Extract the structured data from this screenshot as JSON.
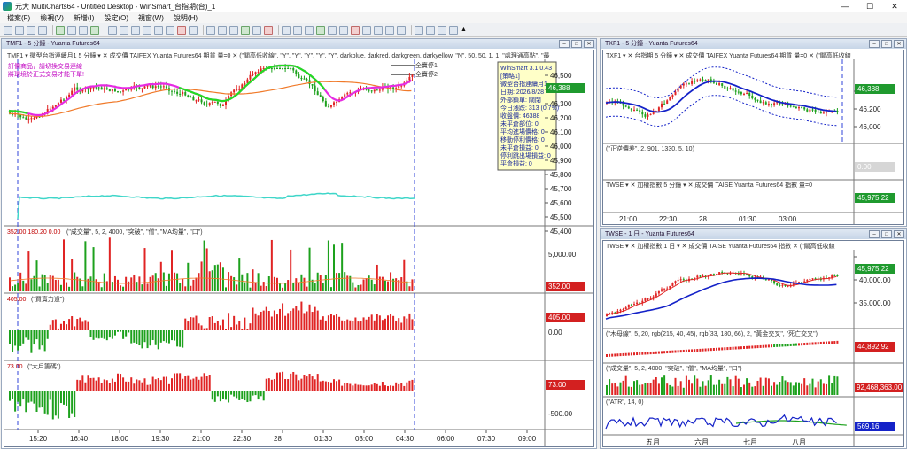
{
  "window": {
    "title": "元大 MultiCharts64 - Untitled Desktop - WinSmart_台指期(台)_1",
    "controls": [
      "—",
      "☐",
      "✕"
    ]
  },
  "menu": [
    "檔案(F)",
    "檢視(V)",
    "新增(I)",
    "設定(O)",
    "視窗(W)",
    "說明(H)"
  ],
  "toolbar": {
    "arrow": "▲"
  },
  "left_window": {
    "title": "TMF1 - 5 分鐘 - Yuanta Futures64",
    "header_line": "TMF1  ▾  微型台指連續月1  5 分鐘  ▾  ✕  成交價  TAIFEX  Yuanta Futures64  期貨  量=0  ✕  (\"關高低收線\", \"Y\", \"Y\", \"Y\", \"Y\", \"Y\", darkblue, darkred, darkgreen, darkyellow, \"N\", 50, 50, 1, 1, \"處理通高點\", \"最",
    "notice": "訂價商品，請切換交易連線\n將環境於正式交易才能下單!",
    "labels": [
      "全賣停1",
      "全賣停2"
    ],
    "info_box": [
      "WinSmart 3.1.0.43",
      "[策略1]",
      "微型台指連續月1",
      "日期: 2026/8/28",
      "外部鎖單: 關閉",
      "今日漲跌: 313 (0.7%)",
      "收盤價: 46388",
      "未平倉部位: 0",
      "平均進場價格: 0",
      "移動停利價格: 0",
      "未平倉損益: 0",
      "停利跳出場損益: 0",
      "平倉損益: 0"
    ],
    "price_axis": [
      "46,500",
      "46,400",
      "46,300",
      "46,200",
      "46,100",
      "46,000",
      "45,900",
      "45,800",
      "45,700",
      "45,600",
      "45,500",
      "45,400"
    ],
    "last_price": "46,388",
    "vol_header": "352.00  180.20  0.00",
    "vol_study": "(\"成交量\", 5, 2, 4000, \"突破\", \"僧\", \"MA均量\", \"口\")",
    "vol_axis": [
      "5,000.00"
    ],
    "vol_last": "352.00",
    "p3_value": "405.00",
    "p3_study": "(\"買賣力道\")",
    "p3_axis": [
      "0.00"
    ],
    "p3_last": "405.00",
    "p4_value": "73.00",
    "p4_study": "(\"大戶籌碼\")",
    "p4_axis": [
      "-500.00"
    ],
    "p4_last": "73.00",
    "time_axis": [
      "15:20",
      "16:40",
      "18:00",
      "19:30",
      "21:00",
      "22:30",
      "28",
      "01:30",
      "03:00",
      "04:30",
      "06:00",
      "07:30",
      "09:00"
    ]
  },
  "right_top_window": {
    "title": "TXF1 - 5 分鐘 - Yuanta Futures64",
    "header_line": "TXF1  ▾  ✕  台指期  5 分鐘  ▾  ✕  成交價  TAIFEX  Yuanta Futures64  期貨  量=0  ✕  (\"關高低收線",
    "price_axis": [
      "46,400",
      "46,200",
      "46,000"
    ],
    "last_price": "46,388",
    "p2_study": "(\"正逆價差\", 2, 901, 1330, 5, 10)",
    "p2_last": "0.00",
    "p3_line": "TWSE  ▾  ✕  加權指數  5 分鐘  ▾  ✕  成交價  TAISE  Yuanta Futures64  指數  量=0",
    "p3_last": "45,975.22",
    "time_axis": [
      "21:00",
      "22:30",
      "28",
      "01:30",
      "03:00"
    ]
  },
  "right_bottom_window": {
    "title": "TWSE - 1 日 - Yuanta Futures64",
    "header_line": "TWSE  ▾  ✕  加權指數  1 日  ▾  ✕  成交價  TAISE  Yuanta Futures64  指數  ✕  (\"關高低收線",
    "price_axis": [
      "45,000.00",
      "40,000.00",
      "35,000.00"
    ],
    "last_price": "45,975.22",
    "p2_study": "(\"木母線\", 5, 20, rgb(215, 40, 45), rgb(33, 180, 66), 2, \"黃金交叉\", \"死亡交叉\")",
    "p2_last": "44,892.92",
    "p3_study": "(\"成交量\", 5, 2, 4000, \"突破\", \"僧\", \"MA均量\", \"口\")",
    "p3_last": "92,468,363.00",
    "p4_study": "(\"ATR\", 14, 0)",
    "p4_last": "569.16",
    "time_axis": [
      "五月",
      "六月",
      "七月",
      "八月"
    ]
  },
  "colors": {
    "up": "#e02424",
    "down": "#1da11d",
    "ma_pink": "#e62be3",
    "ma_green": "#22dd22",
    "orange": "#f07a2a",
    "cyan": "#3fd6c9",
    "blue": "#1422c8",
    "accent": "#1f7a1f"
  }
}
